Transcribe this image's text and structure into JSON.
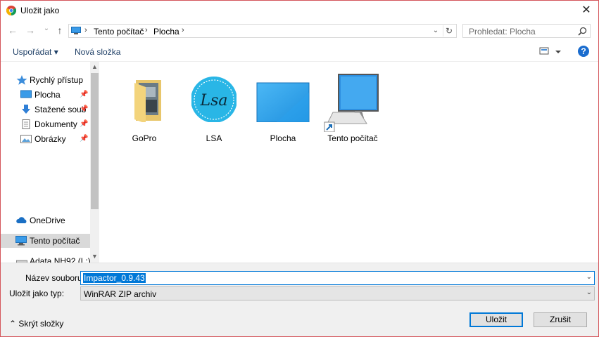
{
  "window": {
    "title": "Uložit jako",
    "close": "✕"
  },
  "nav": {
    "back": "←",
    "forward": "→",
    "recent": "⌄",
    "up": "↑"
  },
  "address": {
    "crumbs": [
      "Tento počítač",
      "Plocha"
    ],
    "separator": "›",
    "dropdown": "⌄",
    "refresh": "↻"
  },
  "search": {
    "placeholder": "Prohledat: Plocha"
  },
  "toolbar": {
    "organize": "Uspořádat ▾",
    "new_folder": "Nová složka",
    "help": "?"
  },
  "navpane": {
    "items": [
      {
        "label": "Rychlý přístup",
        "icon": "star-icon"
      },
      {
        "label": "Plocha",
        "icon": "desktop-icon",
        "pinned": true
      },
      {
        "label": "Stažené soub",
        "icon": "download-icon",
        "pinned": true
      },
      {
        "label": "Dokumenty",
        "icon": "document-icon",
        "pinned": true
      },
      {
        "label": "Obrázky",
        "icon": "pictures-icon",
        "pinned": true
      },
      {
        "label": "OneDrive",
        "icon": "cloud-icon"
      },
      {
        "label": "Tento počítač",
        "icon": "computer-icon",
        "selected": true
      },
      {
        "label": "Adata NH92 (L:)",
        "icon": "drive-icon"
      }
    ],
    "pin_glyph": "📌"
  },
  "files": [
    {
      "label": "GoPro",
      "icon": "folder-icon"
    },
    {
      "label": "LSA",
      "icon": "lsa-logo-icon",
      "logo_text": "Lsa"
    },
    {
      "label": "Plocha",
      "icon": "desktop-wallpaper-icon"
    },
    {
      "label": "Tento počítač",
      "icon": "computer-shortcut-icon"
    }
  ],
  "form": {
    "filename_label": "Název souboru:",
    "filename_value": "Impactor_0.9.43",
    "filetype_label": "Uložit jako typ:",
    "filetype_value": "WinRAR ZIP archiv",
    "dropdown_glyph": "⌄"
  },
  "footer": {
    "hide_folders": "⌃  Skrýt složky",
    "save": "Uložit",
    "cancel": "Zrušit"
  },
  "colors": {
    "accent": "#0078d7",
    "border": "#d4555b",
    "link": "#1e3f66"
  }
}
